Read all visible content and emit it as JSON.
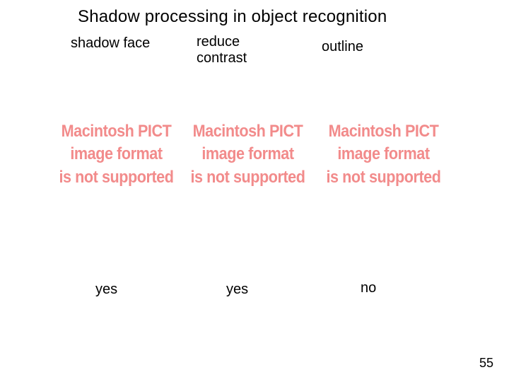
{
  "title": "Shadow processing  in object recognition",
  "columns": [
    {
      "header": "shadow face",
      "answer": "yes"
    },
    {
      "header": "reduce contrast",
      "answer": "yes"
    },
    {
      "header": "outline",
      "answer": "no"
    }
  ],
  "placeholder": {
    "line1": "Macintosh PICT",
    "line2": "image format",
    "line3": "is not supported"
  },
  "page_number": "55"
}
